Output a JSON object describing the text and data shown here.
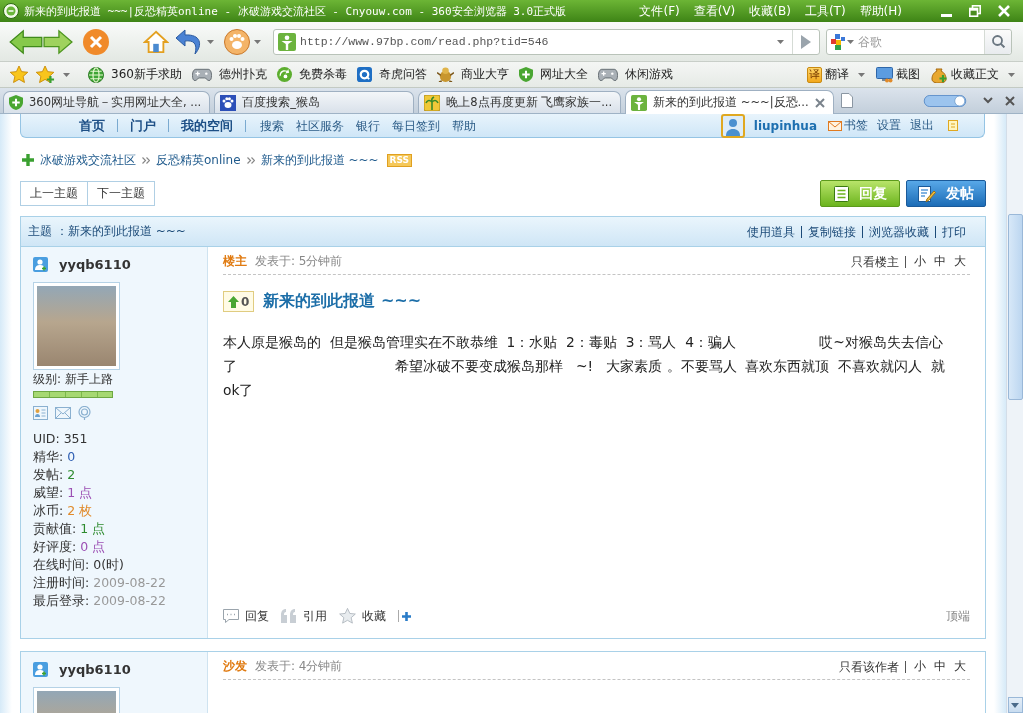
{
  "window": {
    "title": "新来的到此报道 ~~~|反恐精英online - 冰破游戏交流社区 - Cnyouw.com - 360安全浏览器 3.0正式版",
    "menu": [
      "文件(F)",
      "查看(V)",
      "收藏(B)",
      "工具(T)",
      "帮助(H)"
    ]
  },
  "toolbar": {
    "url": "http://www.97bp.com/read.php?tid=546",
    "search": {
      "placeholder": "谷歌"
    }
  },
  "bookmarks": {
    "items": [
      "360新手求助",
      "德州扑克",
      "免费杀毒",
      "奇虎问答",
      "商业大亨",
      "网址大全",
      "休闲游戏"
    ],
    "tools": [
      {
        "label": "翻译",
        "badge": "译",
        "dropdown": true
      },
      {
        "label": "截图",
        "dropdown": false
      },
      {
        "label": "收藏正文",
        "dropdown": true
      }
    ]
  },
  "tabs": [
    {
      "label": "360网址导航－实用网址大全, ...",
      "selected": false
    },
    {
      "label": "百度搜索_猴岛",
      "selected": false
    },
    {
      "label": "晚上8点再度更新 飞鹰家族一...",
      "selected": false
    },
    {
      "label": "新来的到此报道 ~~~|反恐...",
      "selected": true
    }
  ],
  "page": {
    "nav": {
      "main_links": [
        "首页",
        "门户",
        "我的空间"
      ],
      "links": [
        "搜索",
        "社区服务",
        "银行",
        "每日签到",
        "帮助"
      ],
      "user": "liupinhua",
      "user_links": [
        "书签",
        "设置",
        "退出"
      ]
    },
    "breadcrumb": [
      "冰破游戏交流社区",
      "反恐精英online",
      "新来的到此报道 ~~~"
    ],
    "rss": "RSS",
    "pager": [
      "上一主题",
      "下一主题"
    ],
    "actions": [
      {
        "kind": "reply",
        "label": "回复"
      },
      {
        "kind": "post",
        "label": "发帖"
      }
    ],
    "thread_header": {
      "title": "主题 ：新来的到此报道 ~~~",
      "links": [
        "使用道具",
        "复制链接",
        "浏览器收藏",
        "打印"
      ]
    },
    "posts": [
      {
        "author": "yyqb6110",
        "rank": "级别: 新手上路",
        "level": 1,
        "stats": [
          {
            "label": "UID:",
            "value": "351",
            "color": "#333333"
          },
          {
            "label": "精华:",
            "value": "0",
            "color": "#2f5fb3"
          },
          {
            "label": "发帖:",
            "value": "2",
            "color": "#2e8b2e"
          },
          {
            "label": "威望:",
            "value": "1 点",
            "color": "#9b4fb3"
          },
          {
            "label": "冰币:",
            "value": "2 枚",
            "color": "#e08a2a"
          },
          {
            "label": "贡献值:",
            "value": "1 点",
            "color": "#2e8b2e"
          },
          {
            "label": "好评度:",
            "value": "0 点",
            "color": "#9b4fb3"
          },
          {
            "label": "在线时间:",
            "value": "0(时)",
            "color": "#333333"
          },
          {
            "label": "注册时间:",
            "value": "2009-08-22",
            "color": "#999999"
          },
          {
            "label": "最后登录:",
            "value": "2009-08-22",
            "color": "#999999"
          }
        ],
        "floor": "楼主",
        "posted": "发表于: 5分钟前",
        "filter": "只看楼主",
        "sizes": [
          "小",
          "中",
          "大"
        ],
        "votes": "0",
        "title": "新来的到此报道 ~~~",
        "body": "本人原是猴岛的  但是猴岛管理实在不敢恭维  1：水贴  2：毒贴  3：骂人  4：骗人                   哎~对猴岛失去信心了                                    希望冰破不要变成猴岛那样   ~!   大家素质 。不要骂人  喜欢东西就顶  不喜欢就闪人  就ok了",
        "actions": [
          {
            "kind": "reply",
            "label": "回复"
          },
          {
            "kind": "quote",
            "label": "引用"
          },
          {
            "kind": "favorite",
            "label": "收藏"
          }
        ],
        "top": "顶端"
      },
      {
        "author": "yyqb6110",
        "floor": "沙发",
        "posted": "发表于: 4分钟前",
        "filter": "只看该作者",
        "sizes": [
          "小",
          "中",
          "大"
        ]
      }
    ]
  }
}
